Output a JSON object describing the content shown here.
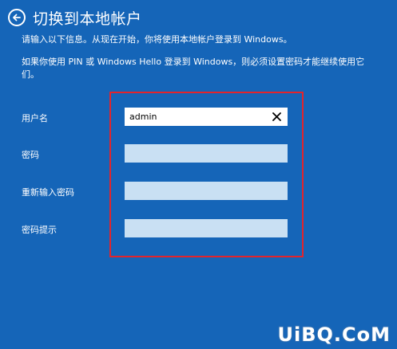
{
  "header": {
    "title": "切换到本地帐户"
  },
  "description": {
    "line1": "请输入以下信息。从现在开始，你将使用本地帐户登录到 Windows。",
    "line2": "如果你使用 PIN 或 Windows Hello 登录到 Windows，则必须设置密码才能继续使用它们。"
  },
  "form": {
    "username_label": "用户名",
    "username_value": "admin",
    "password_label": "密码",
    "password_value": "",
    "reenter_label": "重新输入密码",
    "reenter_value": "",
    "hint_label": "密码提示",
    "hint_value": ""
  },
  "watermark": "UiBQ.CoM",
  "colors": {
    "background": "#1565b8",
    "input_empty": "#c9e0f3",
    "highlight_border": "#e3242b"
  }
}
